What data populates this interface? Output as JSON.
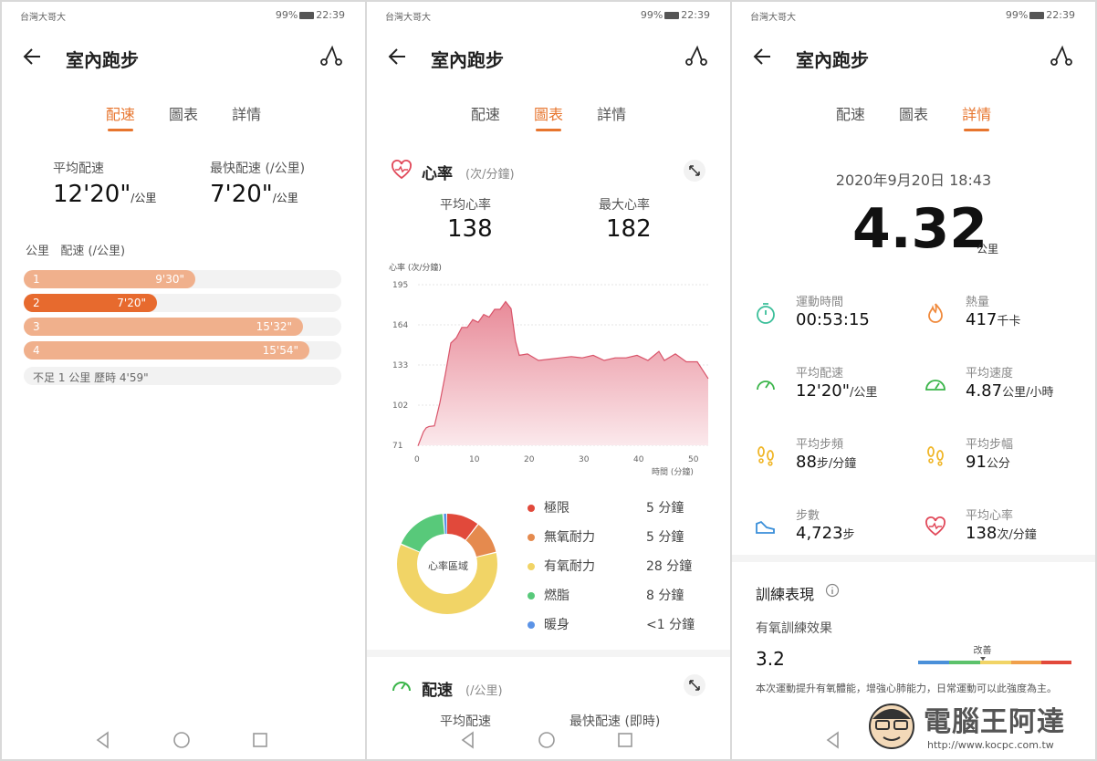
{
  "status": {
    "carrier": "台灣大哥大",
    "battery": "99%",
    "time": "22:39"
  },
  "app": {
    "title": "室內跑步"
  },
  "tabs": [
    "配速",
    "圖表",
    "詳情"
  ],
  "pace_screen": {
    "avg_label": "平均配速",
    "avg_value": "12'20\"",
    "avg_unit": "/公里",
    "fast_label": "最快配速 (/公里)",
    "fast_value": "7'20\"",
    "fast_unit": "/公里",
    "table_header": "公里   配速 (/公里)",
    "rows": [
      {
        "km": "1",
        "pace": "9'30\"",
        "fraction": 0.54,
        "fast": false
      },
      {
        "km": "2",
        "pace": "7'20\"",
        "fraction": 0.42,
        "fast": true
      },
      {
        "km": "3",
        "pace": "15'32\"",
        "fraction": 0.88,
        "fast": false
      },
      {
        "km": "4",
        "pace": "15'54\"",
        "fraction": 0.9,
        "fast": false
      }
    ],
    "remainder": "不足 1 公里 歷時 4'59\""
  },
  "chart_screen": {
    "hr_title": "心率",
    "hr_unit": "(次/分鐘)",
    "avg_hr_label": "平均心率",
    "avg_hr_value": "138",
    "max_hr_label": "最大心率",
    "max_hr_value": "182",
    "chart_ylabel": "心率 (次/分鐘)",
    "chart_xlabel": "時間 (分鐘)",
    "donut_center": "心率區域",
    "zones": [
      {
        "name": "極限",
        "value": "5 分鐘",
        "minutes": 5,
        "color": "#e1493b"
      },
      {
        "name": "無氧耐力",
        "value": "5 分鐘",
        "minutes": 5,
        "color": "#e58a4e"
      },
      {
        "name": "有氧耐力",
        "value": "28 分鐘",
        "minutes": 28,
        "color": "#f1d466"
      },
      {
        "name": "燃脂",
        "value": "8 分鐘",
        "minutes": 8,
        "color": "#58c97a"
      },
      {
        "name": "暖身",
        "value": "<1 分鐘",
        "minutes": 0.6,
        "color": "#5b93e6"
      }
    ],
    "pace_title": "配速",
    "pace_unit": "(/公里)",
    "pace_avg_label": "平均配速",
    "pace_fast_label": "最快配速 (即時)"
  },
  "detail_screen": {
    "datetime": "2020年9月20日 18:43",
    "distance": "4.32",
    "distance_unit": "公里",
    "stats": [
      {
        "icon": "stopwatch-icon",
        "label": "運動時間",
        "value": "00:53:15",
        "unit": ""
      },
      {
        "icon": "flame-icon",
        "label": "熱量",
        "value": "417",
        "unit": "千卡"
      },
      {
        "icon": "gauge-icon",
        "label": "平均配速",
        "value": "12'20\"",
        "unit": "/公里"
      },
      {
        "icon": "speedometer-icon",
        "label": "平均速度",
        "value": "4.87",
        "unit": "公里/小時"
      },
      {
        "icon": "footprints-icon",
        "label": "平均步頻",
        "value": "88",
        "unit": "步/分鐘"
      },
      {
        "icon": "footprints-icon",
        "label": "平均步幅",
        "value": "91",
        "unit": "公分"
      },
      {
        "icon": "shoe-icon",
        "label": "步數",
        "value": "4,723",
        "unit": "步"
      },
      {
        "icon": "heart-icon",
        "label": "平均心率",
        "value": "138",
        "unit": "次/分鐘"
      }
    ],
    "training_title": "訓練表現",
    "aerobic_label": "有氧訓練效果",
    "aerobic_value": "3.2",
    "scale_marker_label": "改善",
    "aerobic_fraction": 0.42,
    "aerobic_desc": "本次運動提升有氧體能，增強心肺能力，日常運動可以此強度為主。",
    "colors": {
      "accent": "#e7752e"
    }
  },
  "watermark": {
    "brand": "電腦王阿達",
    "url": "http://www.kocpc.com.tw"
  }
}
